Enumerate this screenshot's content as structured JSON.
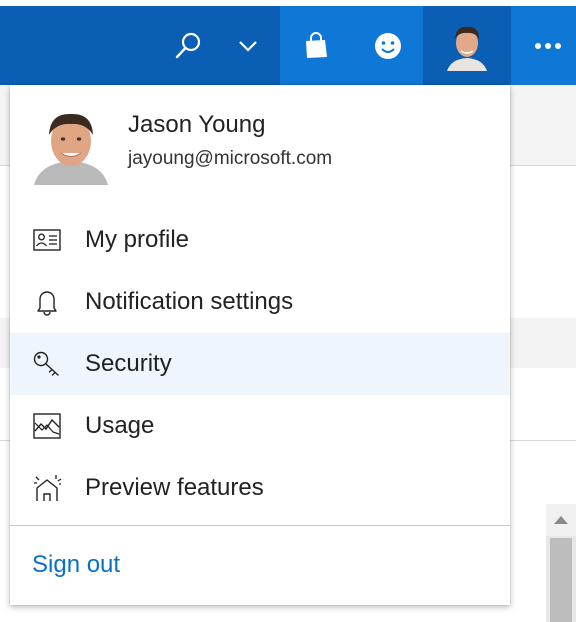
{
  "topbar": {
    "icons": [
      "search-icon",
      "chevron-down-icon",
      "shopping-bag-icon",
      "smiley-icon",
      "avatar",
      "more-icon"
    ],
    "colors": {
      "dark": "#0a5fb4",
      "light": "#0f78d7"
    }
  },
  "user": {
    "name": "Jason Young",
    "email": "jayoung@microsoft.com"
  },
  "menu": {
    "items": [
      {
        "label": "My profile",
        "icon": "id-card-icon"
      },
      {
        "label": "Notification settings",
        "icon": "bell-icon"
      },
      {
        "label": "Security",
        "icon": "key-icon",
        "active": true
      },
      {
        "label": "Usage",
        "icon": "usage-chart-icon"
      },
      {
        "label": "Preview features",
        "icon": "sparkle-icon"
      }
    ],
    "sign_out_label": "Sign out"
  },
  "colors": {
    "accent": "#0a6fcc",
    "active_row": "#eef5fc"
  }
}
